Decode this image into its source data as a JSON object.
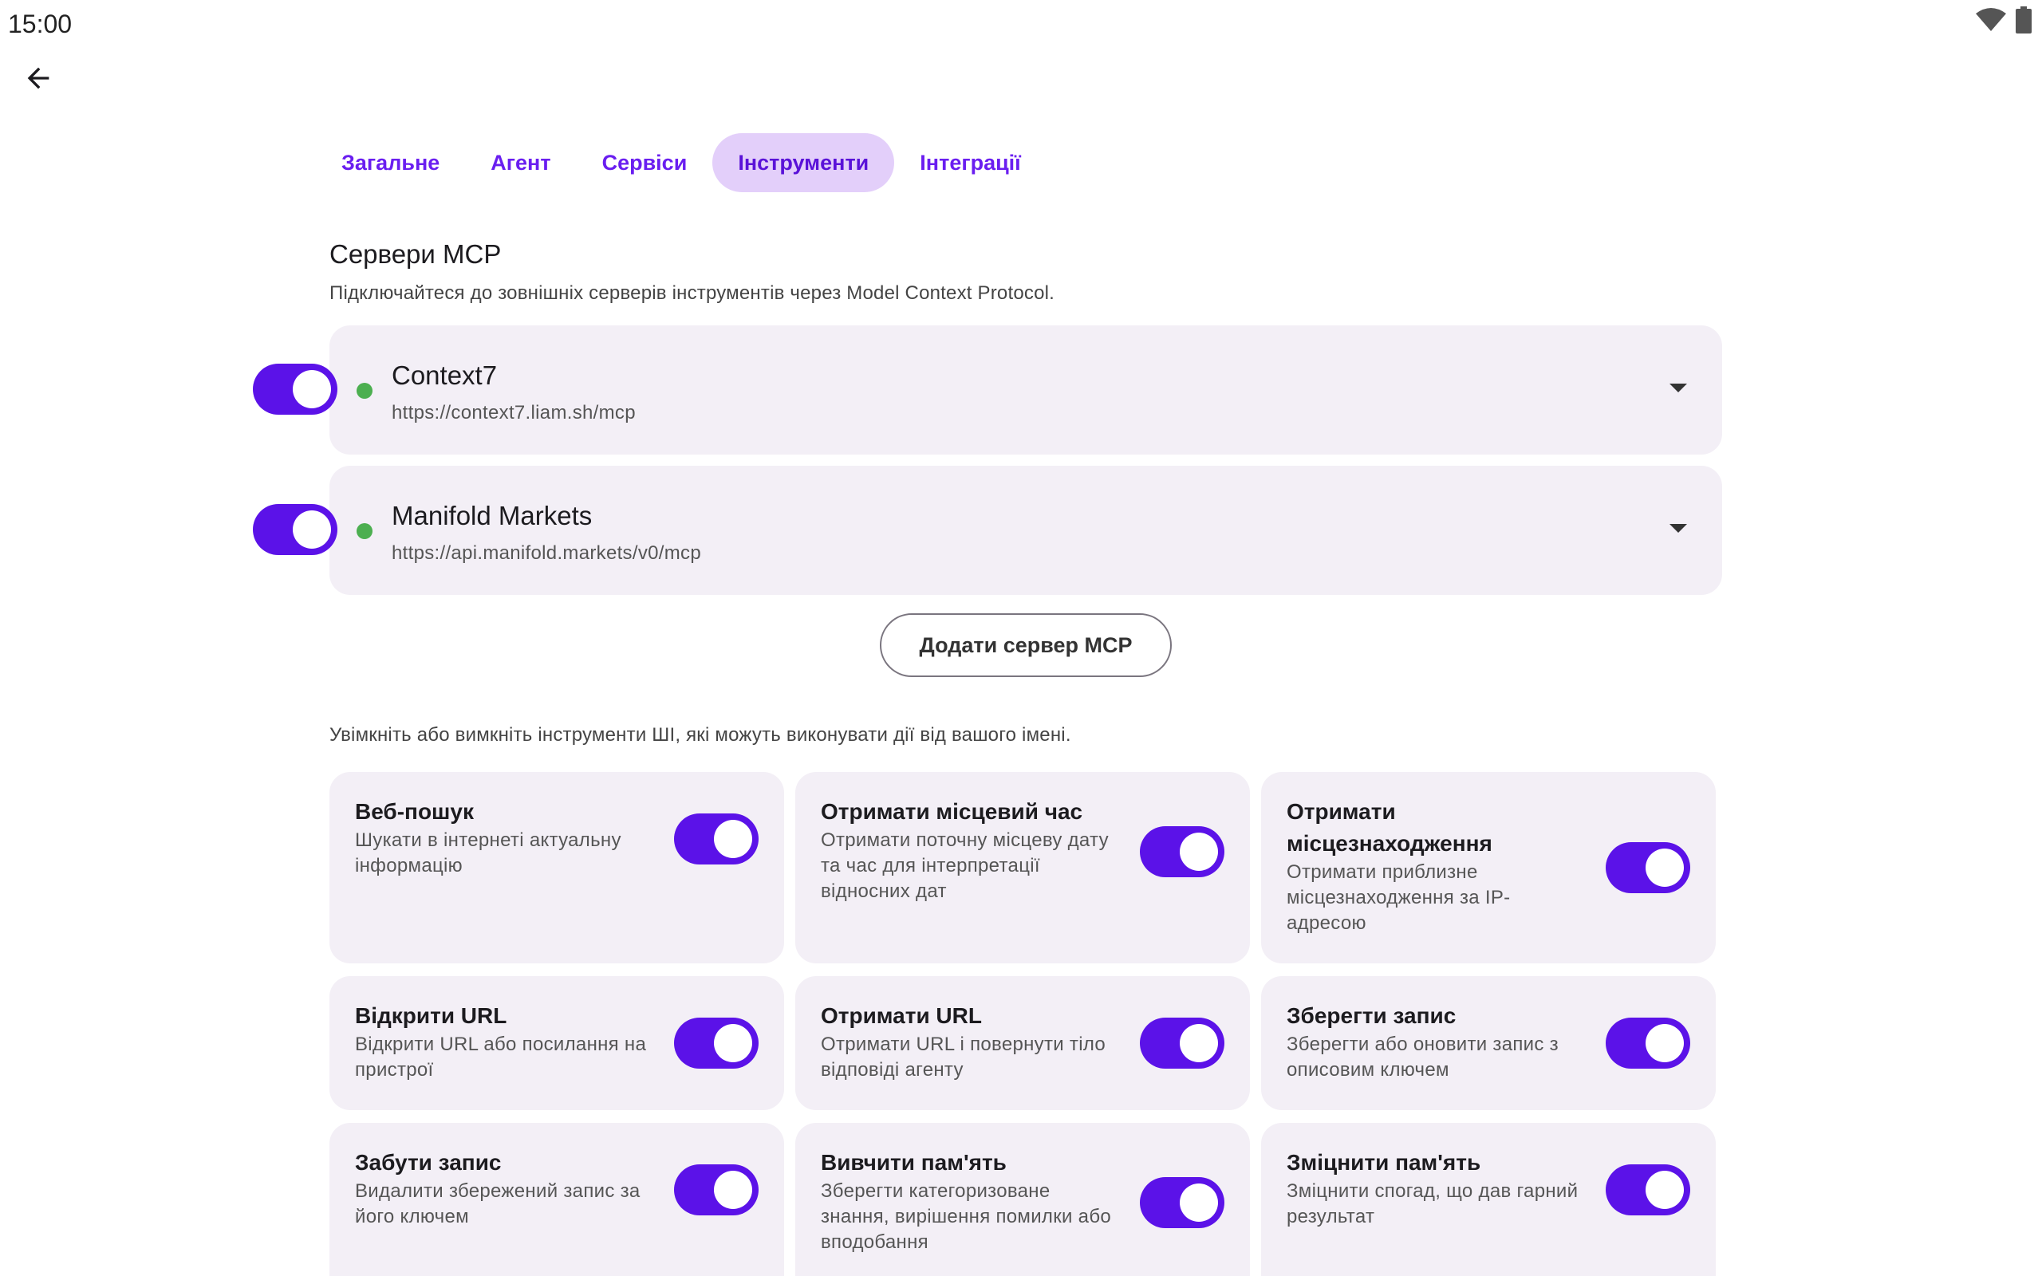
{
  "status_bar": {
    "time": "15:00"
  },
  "tabs": [
    {
      "label": "Загальне"
    },
    {
      "label": "Агент"
    },
    {
      "label": "Сервіси"
    },
    {
      "label": "Інструменти"
    },
    {
      "label": "Інтеграції"
    }
  ],
  "mcp": {
    "title": "Сервери MCP",
    "description": "Підключайтеся до зовнішніх серверів інструментів через Model Context Protocol.",
    "servers": [
      {
        "name": "Context7",
        "url": "https://context7.liam.sh/mcp",
        "enabled": true,
        "status_color": "#4caf50"
      },
      {
        "name": "Manifold Markets",
        "url": "https://api.manifold.markets/v0/mcp",
        "enabled": true,
        "status_color": "#4caf50"
      }
    ],
    "add_button": "Додати сервер MCP"
  },
  "tools": {
    "description": "Увімкніть або вимкніть інструменти ШІ, які можуть виконувати дії від вашого імені.",
    "items": [
      {
        "title": "Веб-пошук",
        "desc": "Шукати в інтернеті актуальну інформацію",
        "enabled": true
      },
      {
        "title": "Отримати місцевий час",
        "desc": "Отримати поточну місцеву дату та час для інтерпретації відносних дат",
        "enabled": true
      },
      {
        "title": "Отримати місцезнаходження",
        "desc": "Отримати приблизне місцезнаходження за IP-адресою",
        "enabled": true
      },
      {
        "title": "Відкрити URL",
        "desc": "Відкрити URL або посилання на пристрої",
        "enabled": true
      },
      {
        "title": "Отримати URL",
        "desc": "Отримати URL і повернути тіло відповіді агенту",
        "enabled": true
      },
      {
        "title": "Зберегти запис",
        "desc": "Зберегти або оновити запис з описовим ключем",
        "enabled": true
      },
      {
        "title": "Забути запис",
        "desc": "Видалити збережений запис за його ключем",
        "enabled": true
      },
      {
        "title": "Вивчити пам'ять",
        "desc": "Зберегти категоризоване знання, вирішення помилки або вподобання",
        "enabled": true
      },
      {
        "title": "Зміцнити пам'ять",
        "desc": "Зміцнити спогад, що дав гарний результат",
        "enabled": true
      }
    ]
  },
  "colors": {
    "accent": "#5b12e8",
    "tab_text": "#6a1ef0",
    "tab_active_bg": "#e3cffa",
    "card_bg": "#f3eff6"
  },
  "icons": {
    "back": "arrow-left-icon",
    "wifi": "wifi-icon",
    "battery": "battery-icon",
    "expand": "chevron-down-icon"
  }
}
